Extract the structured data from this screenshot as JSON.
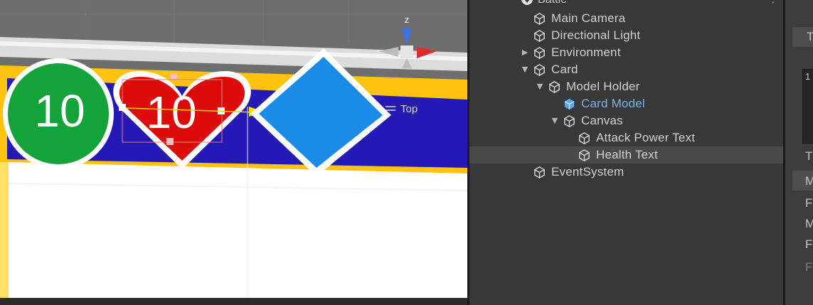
{
  "scene_view": {
    "green_badge_value": "10",
    "heart_badge_value": "10",
    "gizmo_axis_label": "z",
    "gizmo_view_label": "Top",
    "colors": {
      "green_badge": "#14a338",
      "red_heart": "#dd0a0a",
      "blue_diamond": "#1a8be7",
      "card_band": "#2419b4",
      "card_border": "#ffc20e",
      "card_body": "#ffffff"
    }
  },
  "hierarchy": {
    "scene_name": "Battle*",
    "items": [
      {
        "label": "Main Camera",
        "icon": "gameobject-cube-icon"
      },
      {
        "label": "Directional Light",
        "icon": "gameobject-cube-icon"
      },
      {
        "label": "Environment",
        "icon": "gameobject-cube-icon",
        "expander": "collapsed"
      },
      {
        "label": "Card",
        "icon": "gameobject-cube-icon",
        "expander": "expanded"
      },
      {
        "label": "Model Holder",
        "icon": "gameobject-cube-icon",
        "expander": "expanded"
      },
      {
        "label": "Card Model",
        "icon": "prefab-cube-icon"
      },
      {
        "label": "Canvas",
        "icon": "gameobject-cube-icon",
        "expander": "expanded"
      },
      {
        "label": "Attack Power Text",
        "icon": "gameobject-cube-icon"
      },
      {
        "label": "Health Text",
        "icon": "gameobject-cube-icon",
        "selected": true
      },
      {
        "label": "EventSystem",
        "icon": "gameobject-cube-icon"
      }
    ],
    "colors": {
      "text": "#d2d2d2",
      "prefab_text": "#7ab3ee",
      "selection": "#4a4a4a"
    }
  },
  "inspector": {
    "visible_letters": [
      "T",
      "1",
      "T",
      "M",
      "F",
      "M",
      "F",
      "F"
    ]
  }
}
